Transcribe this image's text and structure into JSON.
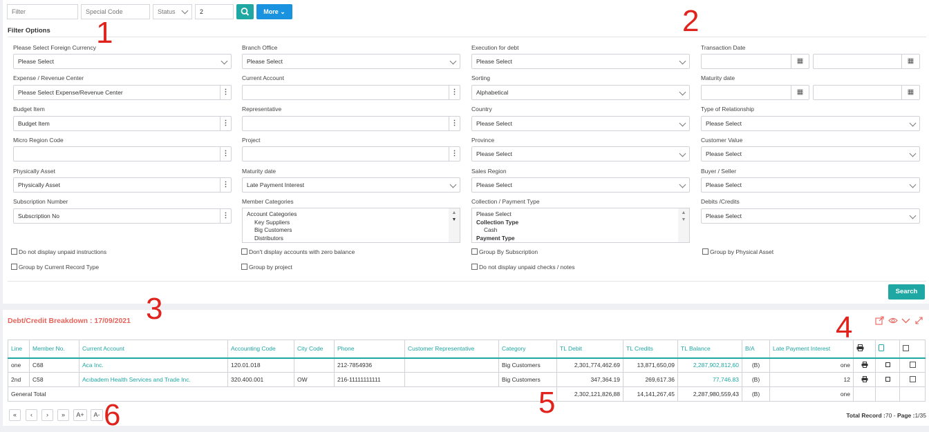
{
  "topbar": {
    "filter_placeholder": "Filter",
    "special_code_placeholder": "Special Code",
    "status_value": "Status",
    "count_value": "2",
    "more_label": "More"
  },
  "filter_options_title": "Filter Options",
  "fields": {
    "foreign_currency": {
      "label": "Please Select Foreign Currency",
      "value": "Please Select"
    },
    "branch_office": {
      "label": "Branch Office",
      "value": "Please Select"
    },
    "execution_for_debt": {
      "label": "Execution for debt",
      "value": "Please Select"
    },
    "transaction_date": {
      "label": "Transaction Date"
    },
    "expense_revenue_center": {
      "label": "Expense / Revenue Center",
      "value": "Please Select Expense/Revenue Center"
    },
    "current_account": {
      "label": "Current Account",
      "value": ""
    },
    "sorting": {
      "label": "Sorting",
      "value": "Alphabetical"
    },
    "maturity_date_top": {
      "label": "Maturity date"
    },
    "budget_item": {
      "label": "Budget Item",
      "value": "Budget Item"
    },
    "representative": {
      "label": "Representative",
      "value": ""
    },
    "country": {
      "label": "Country",
      "value": "Please Select"
    },
    "type_of_relationship": {
      "label": "Type of Relationship",
      "value": "Please Select"
    },
    "micro_region_code": {
      "label": "Micro Region Code",
      "value": ""
    },
    "project": {
      "label": "Project",
      "value": ""
    },
    "province": {
      "label": "Province",
      "value": "Please Select"
    },
    "customer_value": {
      "label": "Customer Value",
      "value": "Please Select"
    },
    "physically_asset": {
      "label": "Physically Asset",
      "value": "Physically Asset"
    },
    "maturity_date": {
      "label": "Maturity date",
      "value": "Late Payment Interest"
    },
    "sales_region": {
      "label": "Sales Region",
      "value": "Please Select"
    },
    "buyer_seller": {
      "label": "Buyer / Seller",
      "value": "Please Select"
    },
    "subscription_number": {
      "label": "Subscription Number",
      "value": "Subscription No"
    },
    "member_categories": {
      "label": "Member Categories",
      "items": [
        "Account Categories",
        "Key Suppliers",
        "Big Customers",
        "Distributors"
      ]
    },
    "collection_payment_type": {
      "label": "Collection / Payment Type",
      "items": [
        "Please Select",
        "Collection Type",
        "Cash",
        "Payment Type"
      ]
    },
    "debits_credits": {
      "label": "Debits /Credits",
      "value": "Please Select"
    }
  },
  "checkboxes": {
    "unpaid_instructions": "Do not display unpaid instructions",
    "zero_balance": "Don't display accounts with zero balance",
    "group_subscription": "Group By Subscription",
    "group_physical_asset": "Group by Physical Asset",
    "group_current_record": "Group by Current Record Type",
    "group_project": "Group by project",
    "unpaid_checks": "Do not display unpaid checks / notes"
  },
  "search_label": "Search",
  "report_title": "Debt/Credit Breakdown : 17/09/2021",
  "table": {
    "headers": [
      "Line",
      "Member No.",
      "Current Account",
      "Accounting Code",
      "City Code",
      "Phone",
      "Customer Representative",
      "Category",
      "TL Debit",
      "TL Credits",
      "TL Balance",
      "B/A",
      "Late Payment Interest"
    ],
    "rows": [
      {
        "line": "one",
        "member": "C68",
        "account": "Aca Inc.",
        "code": "120.01.018",
        "city": "",
        "phone": "212-7854936",
        "rep": "",
        "category": "Big Customers",
        "debit": "2,301,774,462.69",
        "credit": "13,871,650,09",
        "balance": "2,287,902,812,60",
        "ba": "(B)",
        "interest": "one"
      },
      {
        "line": "2nd",
        "member": "C58",
        "account": "Acıbadem Health Services and Trade Inc.",
        "code": "320.400.001",
        "city": "OW",
        "phone": "216-11111111111",
        "rep": "",
        "category": "Big Customers",
        "debit": "347,364.19",
        "credit": "269,617.36",
        "balance": "77,746.83",
        "ba": "(B)",
        "interest": "12"
      }
    ],
    "total": {
      "label": "General Total",
      "debit": "2,302,121,826,88",
      "credit": "14,141,267,45",
      "balance": "2,287,980,559,43",
      "ba": "(B)",
      "interest": "one"
    }
  },
  "pager": {
    "font_up": "A+",
    "font_down": "A-"
  },
  "footer": {
    "total_label": "Total Record :",
    "total_value": "70",
    "sep": "-",
    "page_label": "Page :",
    "page_value": "1/35"
  },
  "annotations": [
    "1",
    "2",
    "3",
    "4",
    "5",
    "6"
  ],
  "colors": {
    "teal": "#1fa7a3",
    "blue": "#1993e0",
    "title_red": "#e8625a",
    "annotation_red": "#e0231c"
  }
}
